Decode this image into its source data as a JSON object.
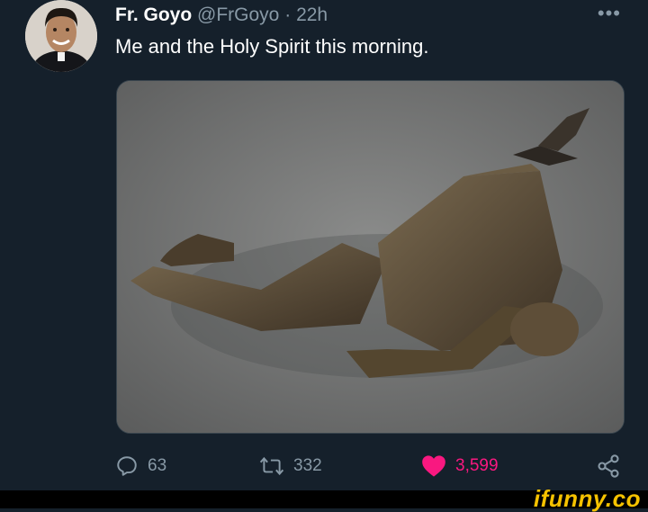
{
  "tweet": {
    "author_name": "Fr. Goyo",
    "author_handle": "@FrGoyo",
    "separator": "·",
    "time": "22h",
    "text": "Me and the Holy Spirit this morning."
  },
  "actions": {
    "replies": "63",
    "retweets": "332",
    "likes": "3,599"
  },
  "icons": {
    "more": "more-options-icon",
    "reply": "reply-icon",
    "retweet": "retweet-icon",
    "like": "heart-icon",
    "share": "share-icon"
  },
  "colors": {
    "background": "#15202b",
    "secondary_text": "#8899a6",
    "like": "#f91880",
    "brand": "#f6c200"
  },
  "footer": {
    "brand": "ifunny.co"
  }
}
